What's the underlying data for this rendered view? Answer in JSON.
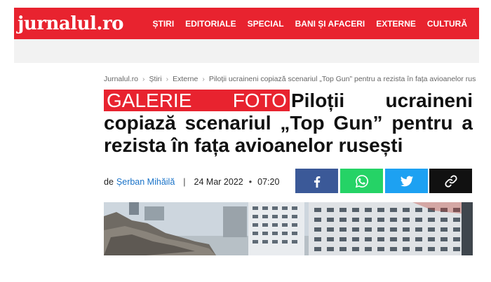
{
  "header": {
    "logo": "jurnalul.ro",
    "nav": [
      "ȘTIRI",
      "EDITORIALE",
      "SPECIAL",
      "BANI ȘI AFACERI",
      "EXTERNE",
      "CULTURĂ"
    ]
  },
  "breadcrumb": {
    "items": [
      "Jurnalul.ro",
      "Știri",
      "Externe"
    ],
    "current": "Piloții ucraineni copiază scenariul „Top Gun” pentru a rezista în fața avioanelor rusești",
    "separator": "›"
  },
  "article": {
    "badge": "GALERIE FOTO",
    "title": "Piloții ucraineni copiază scenariul „Top Gun” pentru a rezista în fața avioanelor rusești",
    "byline_prefix": "de",
    "author": "Șerban Mihăilă",
    "date": "24 Mar 2022",
    "time": "07:20"
  },
  "share": {
    "buttons": [
      {
        "name": "facebook",
        "icon": "facebook-icon",
        "color": "#3b5998"
      },
      {
        "name": "whatsapp",
        "icon": "whatsapp-icon",
        "color": "#25d366"
      },
      {
        "name": "twitter",
        "icon": "twitter-icon",
        "color": "#1da1f2"
      },
      {
        "name": "copy-link",
        "icon": "link-icon",
        "color": "#111111"
      }
    ]
  },
  "colors": {
    "brand_red": "#e8232f",
    "author_link": "#1a73c8"
  }
}
